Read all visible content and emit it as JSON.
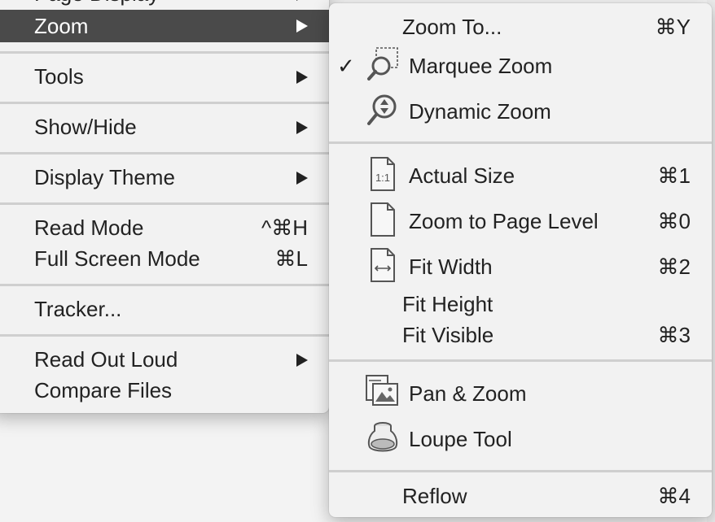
{
  "main_menu": {
    "items": [
      {
        "label": "Page Display"
      },
      {
        "label": "Zoom"
      },
      {
        "label": "Tools"
      },
      {
        "label": "Show/Hide"
      },
      {
        "label": "Display Theme"
      },
      {
        "label": "Read Mode",
        "shortcut": "^⌘H"
      },
      {
        "label": "Full Screen Mode",
        "shortcut": "⌘L"
      },
      {
        "label": "Tracker..."
      },
      {
        "label": "Read Out Loud"
      },
      {
        "label": "Compare Files"
      }
    ]
  },
  "zoom_submenu": {
    "items": [
      {
        "label": "Zoom To...",
        "shortcut": "⌘Y"
      },
      {
        "label": "Marquee Zoom",
        "checked": "✓",
        "icon": "marquee-zoom-icon"
      },
      {
        "label": "Dynamic Zoom",
        "icon": "dynamic-zoom-icon"
      },
      {
        "label": "Actual Size",
        "shortcut": "⌘1",
        "icon": "actual-size-icon",
        "icon_text": "1:1"
      },
      {
        "label": "Zoom to Page Level",
        "shortcut": "⌘0",
        "icon": "page-icon"
      },
      {
        "label": "Fit Width",
        "shortcut": "⌘2",
        "icon": "fit-width-icon"
      },
      {
        "label": "Fit Height"
      },
      {
        "label": "Fit Visible",
        "shortcut": "⌘3"
      },
      {
        "label": "Pan & Zoom",
        "icon": "pan-zoom-icon"
      },
      {
        "label": "Loupe Tool",
        "icon": "loupe-icon"
      },
      {
        "label": "Reflow",
        "shortcut": "⌘4"
      }
    ]
  },
  "colors": {
    "highlight": "#4a4a4a",
    "menu_bg": "#f2f2f2",
    "separator": "#cfcfcf"
  }
}
